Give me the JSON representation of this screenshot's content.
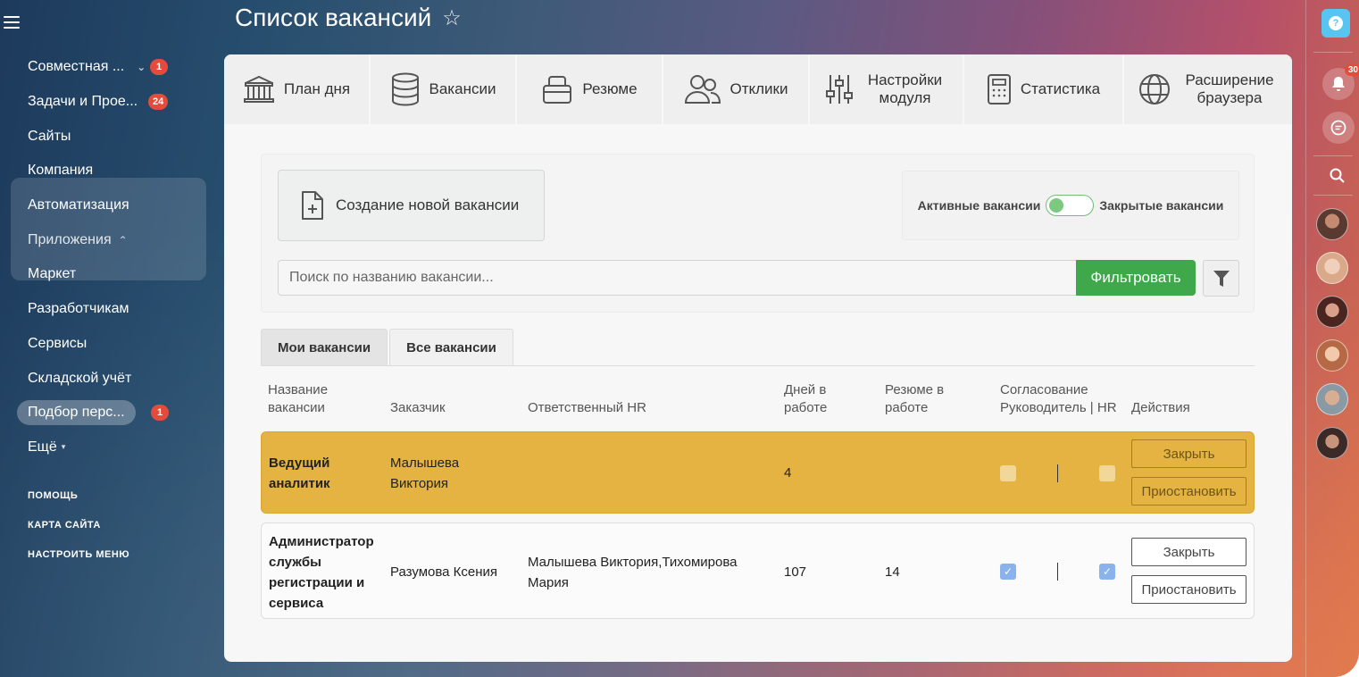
{
  "page": {
    "title": "Список вакансий"
  },
  "sidebar": {
    "items": [
      {
        "label": "Совместная ...",
        "badge": "1",
        "has_chevron": true
      },
      {
        "label": "Задачи и Прое...",
        "badge": "24"
      },
      {
        "label": "Сайты"
      },
      {
        "label": "Компания"
      },
      {
        "label": "Автоматизация"
      },
      {
        "label": "Приложения"
      },
      {
        "label": "Маркет"
      },
      {
        "label": "Разработчикам"
      },
      {
        "label": "Сервисы"
      },
      {
        "label": "Складской учёт"
      },
      {
        "label": "Подбор перс...",
        "badge": "1",
        "active": true
      },
      {
        "label": "Ещё"
      }
    ],
    "links": [
      "ПОМОЩЬ",
      "КАРТА САЙТА",
      "НАСТРОИТЬ МЕНЮ"
    ]
  },
  "rail": {
    "notifications_badge": "30"
  },
  "topnav": [
    {
      "label": "План дня",
      "icon": "bank-icon"
    },
    {
      "label": "Вакансии",
      "icon": "database-icon"
    },
    {
      "label": "Резюме",
      "icon": "briefcase-icon"
    },
    {
      "label": "Отклики",
      "icon": "users-icon"
    },
    {
      "label": "Настройки модуля",
      "icon": "sliders-icon"
    },
    {
      "label": "Статистика",
      "icon": "calculator-icon"
    },
    {
      "label": "Расширение браузера",
      "icon": "globe-icon"
    }
  ],
  "controls": {
    "create_label": "Создание новой вакансии",
    "toggle_left": "Активные вакансии",
    "toggle_right": "Закрытые вакансии",
    "search_placeholder": "Поиск по названию вакансии...",
    "search_value": "",
    "filter_label": "Фильтровать"
  },
  "list_tabs": [
    "Мои вакансии",
    "Все вакансии"
  ],
  "table": {
    "headers": {
      "name": "Название вакансии",
      "customer": "Заказчик",
      "hr": "Ответственный HR",
      "days": "Дней в работе",
      "resumes": "Резюме в работе",
      "approval": "Согласование Руководитель | HR",
      "actions": "Действия"
    },
    "rows": [
      {
        "name": "Ведущий аналитик",
        "customer": "Малышева Виктория",
        "hr": "",
        "days": "4",
        "resumes": "",
        "approval_manager": false,
        "approval_hr": false,
        "close_label": "Закрыть",
        "pause_label": "Приостановить",
        "highlight_color": "#e5b341"
      },
      {
        "name": "Администратор службы регистрации и сервиса",
        "customer": "Разумова Ксения",
        "hr": "Малышева Виктория,Тихомирова Мария",
        "days": "107",
        "resumes": "14",
        "approval_manager": true,
        "approval_hr": true,
        "close_label": "Закрыть",
        "pause_label": "Приостановить"
      }
    ]
  },
  "colors": {
    "accent_green": "#3fa84a",
    "highlight": "#e5b341",
    "badge_red": "#e34c3c",
    "help_blue": "#58c5f0"
  }
}
